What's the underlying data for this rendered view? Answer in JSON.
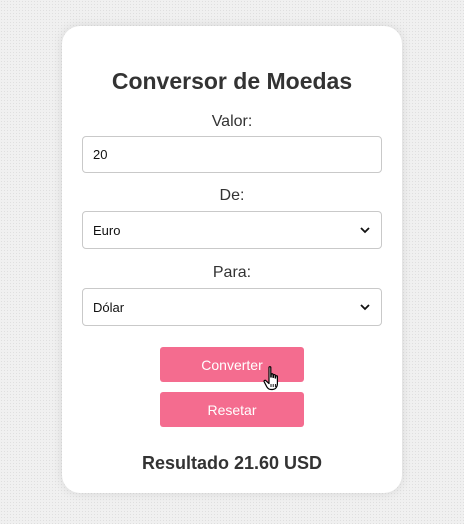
{
  "app": {
    "title": "Conversor de Moedas"
  },
  "form": {
    "amount_label": "Valor:",
    "amount_value": "20",
    "from_label": "De:",
    "from_selected": "Euro",
    "to_label": "Para:",
    "to_selected": "Dólar"
  },
  "actions": {
    "convert_label": "Converter",
    "reset_label": "Resetar"
  },
  "result": {
    "text": "Resultado 21.60 USD"
  },
  "style": {
    "accent_color": "#f46c8f",
    "card_background": "#ffffff",
    "text_color": "#333333"
  },
  "icons": {
    "select_arrow": "chevron-down-icon",
    "cursor": "hand-pointer-cursor-icon"
  }
}
